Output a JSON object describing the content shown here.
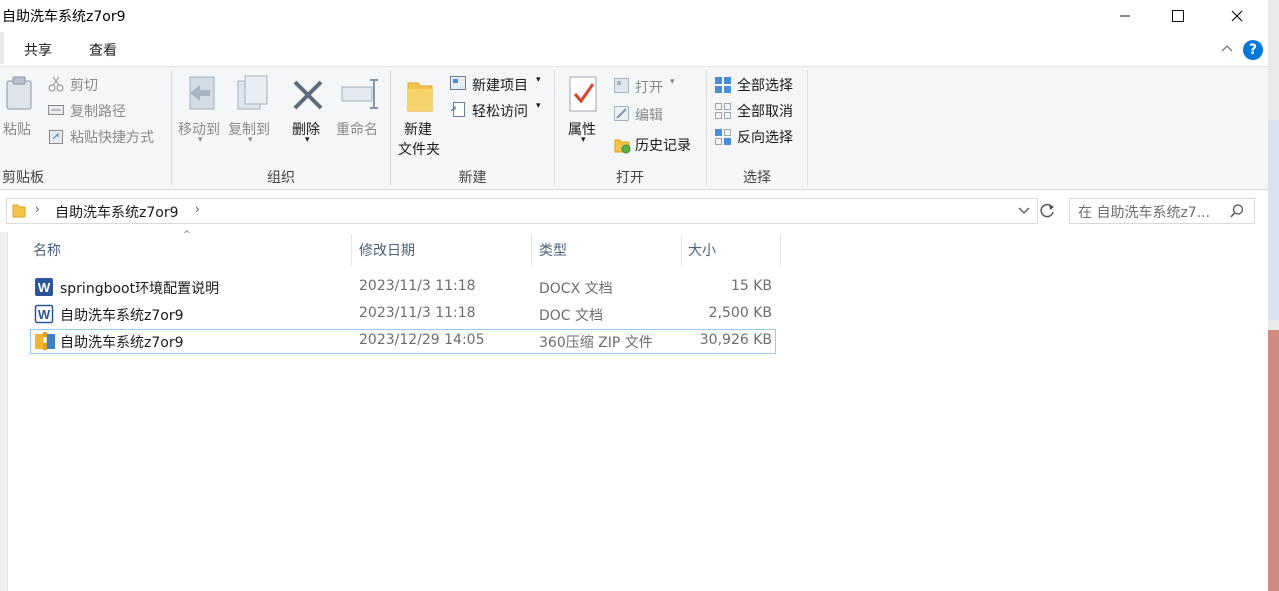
{
  "window": {
    "title": "自助洗车系统z7or9"
  },
  "tabs": [
    {
      "label": "共享"
    },
    {
      "label": "查看"
    }
  ],
  "ribbon": {
    "clipboard": {
      "paste": "粘贴",
      "cut": "剪切",
      "copy_path": "复制路径",
      "paste_shortcut": "粘贴快捷方式",
      "group": "剪贴板"
    },
    "organize": {
      "move_to": "移动到",
      "copy_to": "复制到",
      "delete": "删除",
      "rename": "重命名",
      "group": "组织"
    },
    "new": {
      "new_folder_line1": "新建",
      "new_folder_line2": "文件夹",
      "new_item": "新建项目",
      "easy_access": "轻松访问",
      "group": "新建"
    },
    "open": {
      "properties": "属性",
      "open": "打开",
      "edit": "编辑",
      "history": "历史记录",
      "group": "打开"
    },
    "select": {
      "select_all": "全部选择",
      "select_none": "全部取消",
      "invert": "反向选择",
      "group": "选择"
    }
  },
  "address": {
    "path": "自助洗车系统z7or9",
    "search_placeholder": "在 自助洗车系统z7..."
  },
  "columns": {
    "name": "名称",
    "modified": "修改日期",
    "type": "类型",
    "size": "大小"
  },
  "files": [
    {
      "name": "springboot环境配置说明",
      "modified": "2023/11/3 11:18",
      "type": "DOCX 文档",
      "size": "15 KB",
      "icon": "word-doc-icon"
    },
    {
      "name": "自助洗车系统z7or9",
      "modified": "2023/11/3 11:18",
      "type": "DOC 文档",
      "size": "2,500 KB",
      "icon": "word-doc-icon"
    },
    {
      "name": "自助洗车系统z7or9",
      "modified": "2023/12/29 14:05",
      "type": "360压缩 ZIP 文件",
      "size": "30,926 KB",
      "icon": "zip-archive-icon"
    }
  ],
  "colors": {
    "accent": "#0078d7",
    "selection_border": "#99c9ef",
    "word_blue": "#2b579a",
    "folder_yellow": "#f2c44e"
  },
  "help_label": "?"
}
